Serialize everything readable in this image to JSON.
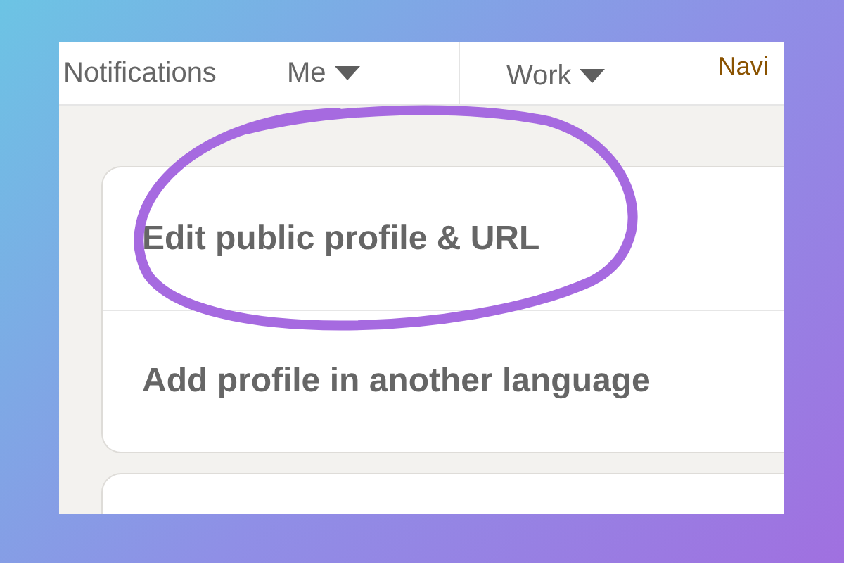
{
  "nav": {
    "items": [
      {
        "label": "Notifications",
        "kind": "text"
      },
      {
        "label": "Me",
        "kind": "dropdown"
      },
      {
        "label": "Work",
        "kind": "dropdown"
      },
      {
        "label": "Navi",
        "kind": "link"
      }
    ]
  },
  "settings_card": {
    "rows": [
      "Edit public profile & URL",
      "Add profile in another language"
    ]
  }
}
